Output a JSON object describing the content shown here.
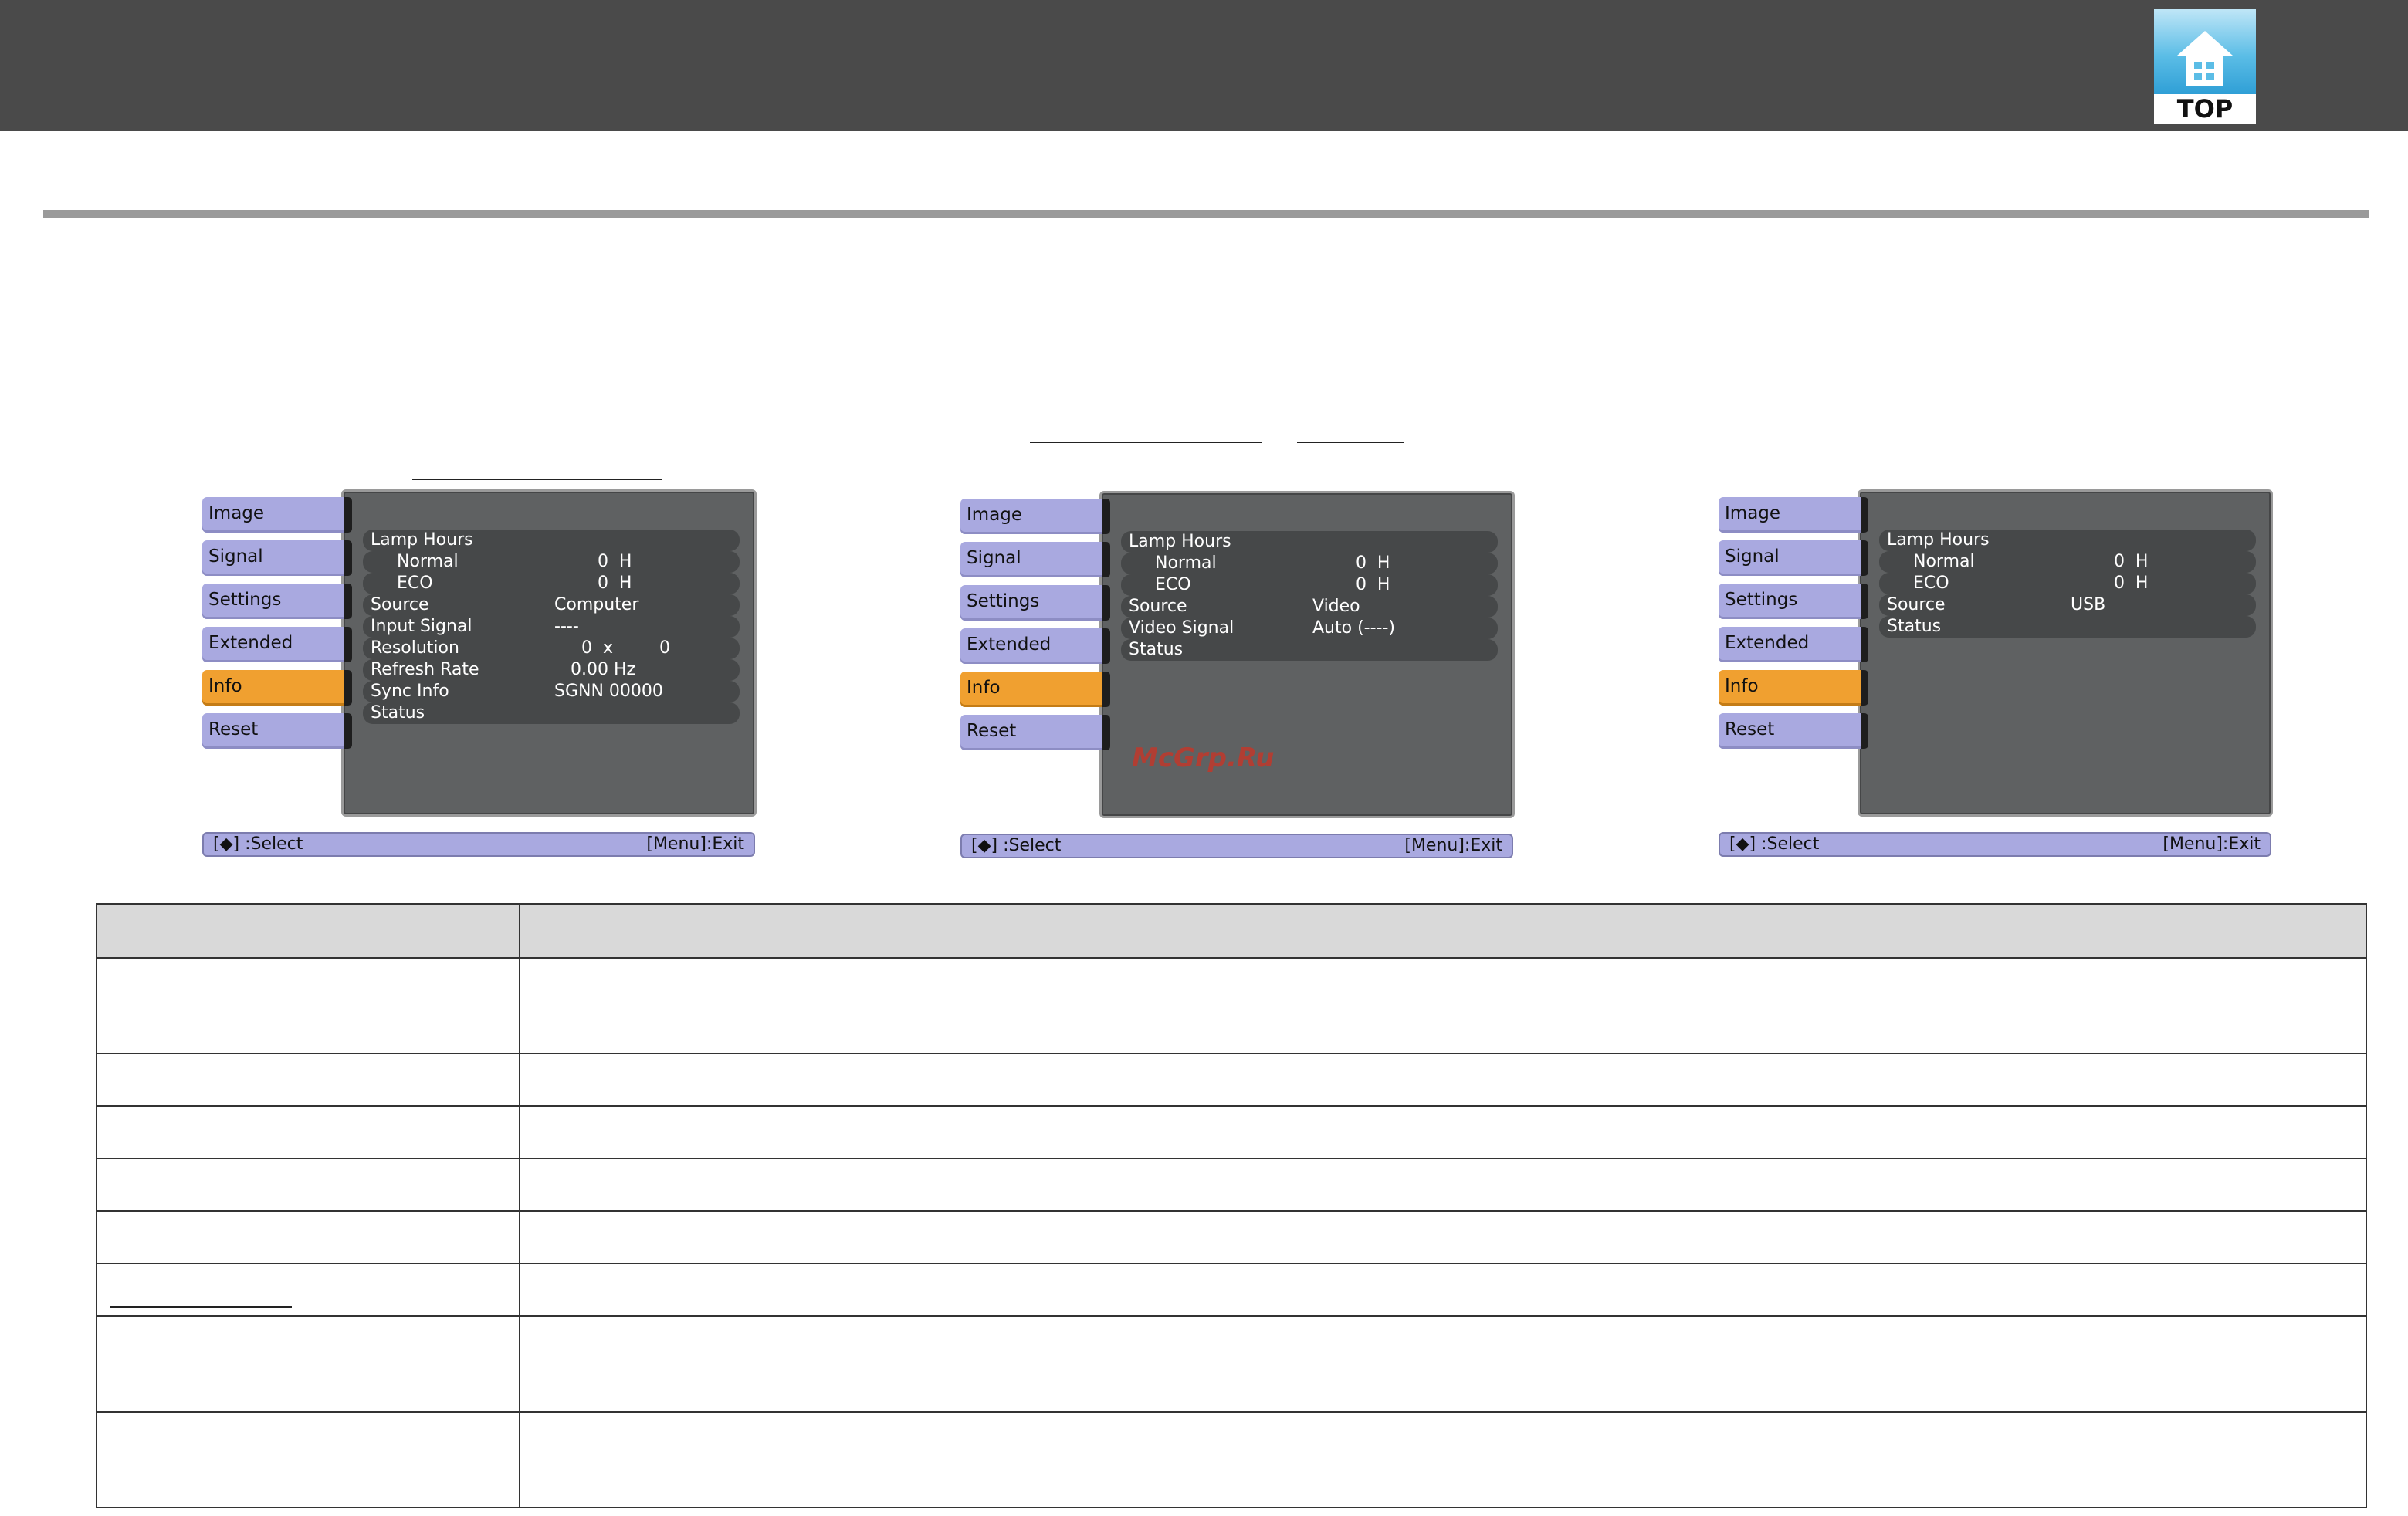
{
  "header": {
    "logo_label": "TOP"
  },
  "watermark": "McGrp.Ru",
  "menus": [
    {
      "tabs": [
        "Image",
        "Signal",
        "Settings",
        "Extended",
        "Info",
        "Reset"
      ],
      "active_tab": "Info",
      "rows": [
        {
          "key": "Lamp Hours",
          "value": "",
          "value2": "",
          "indent": false
        },
        {
          "key": "Normal",
          "value": "        0  H",
          "value2": "",
          "indent": true
        },
        {
          "key": "ECO",
          "value": "        0  H",
          "value2": "",
          "indent": true
        },
        {
          "key": "Source",
          "value": "Computer",
          "value2": "",
          "indent": false
        },
        {
          "key": "Input Signal",
          "value": "----",
          "value2": "",
          "indent": false
        },
        {
          "key": "Resolution",
          "value": "     0  x",
          "value2": "0",
          "indent": false
        },
        {
          "key": "Refresh Rate",
          "value": "   0.00 Hz",
          "value2": "",
          "indent": false
        },
        {
          "key": "Sync Info",
          "value": "SGNN 00000",
          "value2": "",
          "indent": false
        },
        {
          "key": "Status",
          "value": "",
          "value2": "",
          "indent": false
        }
      ],
      "footer_left": "[◆] :Select",
      "footer_right": "[Menu]:Exit"
    },
    {
      "tabs": [
        "Image",
        "Signal",
        "Settings",
        "Extended",
        "Info",
        "Reset"
      ],
      "active_tab": "Info",
      "rows": [
        {
          "key": "Lamp Hours",
          "value": "",
          "value2": "",
          "indent": false
        },
        {
          "key": "Normal",
          "value": "        0  H",
          "value2": "",
          "indent": true
        },
        {
          "key": "ECO",
          "value": "        0  H",
          "value2": "",
          "indent": true
        },
        {
          "key": "Source",
          "value": "Video",
          "value2": "",
          "indent": false
        },
        {
          "key": "Video Signal",
          "value": "Auto (----)",
          "value2": "",
          "indent": false
        },
        {
          "key": "Status",
          "value": "",
          "value2": "",
          "indent": false
        }
      ],
      "footer_left": "[◆] :Select",
      "footer_right": "[Menu]:Exit"
    },
    {
      "tabs": [
        "Image",
        "Signal",
        "Settings",
        "Extended",
        "Info",
        "Reset"
      ],
      "active_tab": "Info",
      "rows": [
        {
          "key": "Lamp Hours",
          "value": "",
          "value2": "",
          "indent": false
        },
        {
          "key": "Normal",
          "value": "        0  H",
          "value2": "",
          "indent": true
        },
        {
          "key": "ECO",
          "value": "        0  H",
          "value2": "",
          "indent": true
        },
        {
          "key": "Source",
          "value": "USB",
          "value2": "",
          "indent": false
        },
        {
          "key": "Status",
          "value": "",
          "value2": "",
          "indent": false
        }
      ],
      "footer_left": "[◆] :Select",
      "footer_right": "[Menu]:Exit"
    }
  ]
}
